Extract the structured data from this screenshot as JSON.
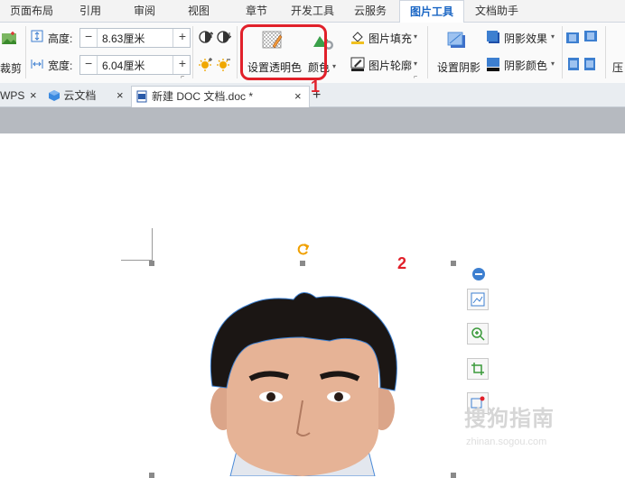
{
  "ribbon_tabs": [
    {
      "label": "页面布局"
    },
    {
      "label": "引用"
    },
    {
      "label": "审阅"
    },
    {
      "label": "视图"
    },
    {
      "label": "章节"
    },
    {
      "label": "开发工具"
    },
    {
      "label": "云服务"
    },
    {
      "label": "图片工具"
    },
    {
      "label": "文档助手"
    }
  ],
  "active_tab": "图片工具",
  "toolbar": {
    "crop_label": "裁剪",
    "height_label": "高度:",
    "height_value": "8.63厘米",
    "width_label": "宽度:",
    "width_value": "6.04厘米",
    "minus": "−",
    "plus": "+",
    "set_transparent_label": "设置透明色",
    "color_label": "颜色",
    "fill_label": "图片填充",
    "outline_label": "图片轮廓",
    "set_shadow_label": "设置阴影",
    "shadow_effect_label": "阴影效果",
    "shadow_color_label": "阴影颜色",
    "compress_label": "压",
    "dropdown_glyph": "▾"
  },
  "doc_tabs": {
    "wps_label": "WPS",
    "cloud_label": "云文档",
    "doc_label": "新建 DOC 文档.doc *",
    "close_glyph": "×",
    "add_glyph": "+"
  },
  "annotations": {
    "marker_1": "1",
    "marker_2": "2"
  },
  "colors": {
    "accent": "#1a66c4",
    "highlight_red": "#e1202a"
  },
  "watermark": {
    "text": "搜狗指南",
    "sub": "zhinan.sogou.com"
  }
}
